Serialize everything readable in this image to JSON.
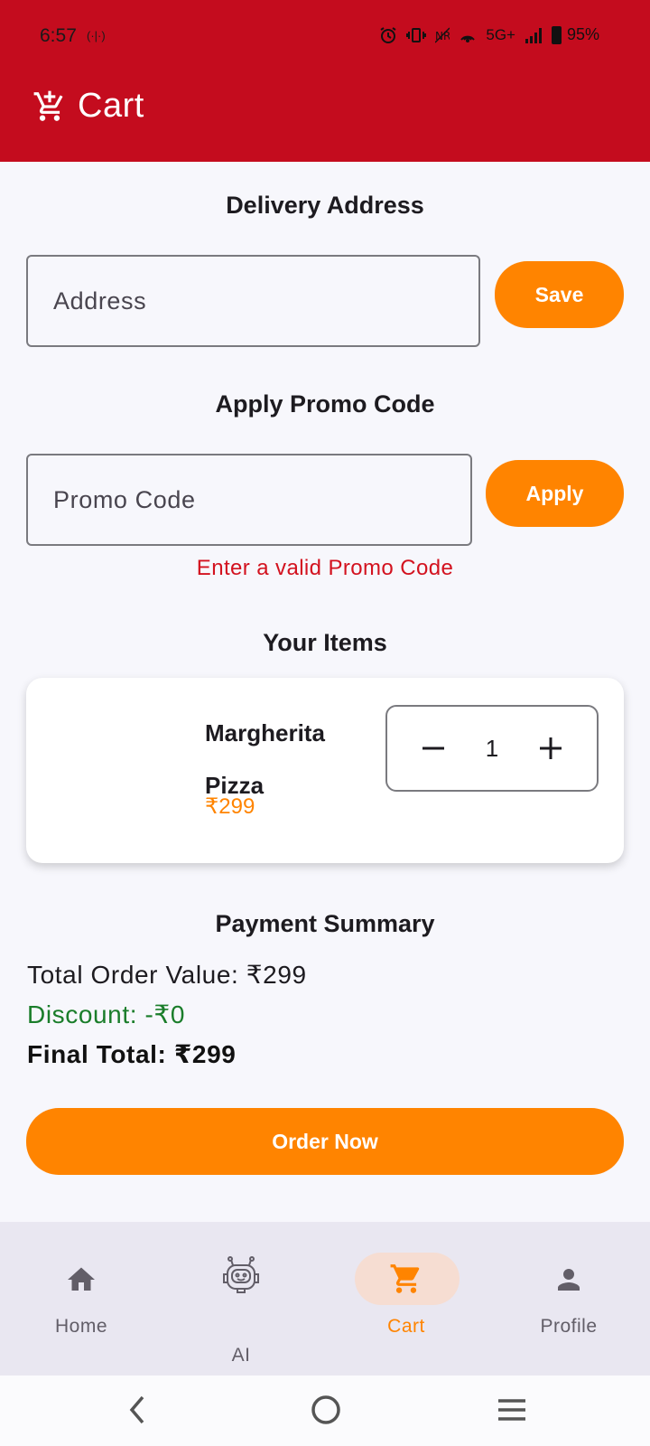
{
  "status": {
    "time": "6:57",
    "time_extra": "(·|·)",
    "network": "5G+",
    "battery": "95%"
  },
  "appbar": {
    "title": "Cart",
    "icon": "cart-plus-icon"
  },
  "delivery": {
    "title": "Delivery Address",
    "placeholder": "Address",
    "save_label": "Save"
  },
  "promo": {
    "title": "Apply Promo Code",
    "placeholder": "Promo Code",
    "apply_label": "Apply",
    "error": "Enter a valid Promo Code"
  },
  "items": {
    "title": "Your Items",
    "list": [
      {
        "name": "Margherita Pizza",
        "price": "₹299",
        "quantity": "1"
      }
    ]
  },
  "summary": {
    "title": "Payment Summary",
    "total_order_value": "Total Order Value: ₹299",
    "discount": "Discount: -₹0",
    "final_total": "Final Total: ₹299"
  },
  "order_button": "Order Now",
  "bottom_nav": {
    "items": [
      {
        "label": "Home",
        "icon": "home-icon"
      },
      {
        "label": "AI",
        "icon": "robot-icon"
      },
      {
        "label": "Cart",
        "icon": "cart-icon",
        "selected": true
      },
      {
        "label": "Profile",
        "icon": "person-icon"
      }
    ]
  },
  "colors": {
    "appbar": "#c40c1e",
    "accent": "#ff8400",
    "error": "#d3121f",
    "discount": "#1a7d2a",
    "nav_background": "#e9e7f1",
    "nav_pill": "#f6ddd2"
  }
}
